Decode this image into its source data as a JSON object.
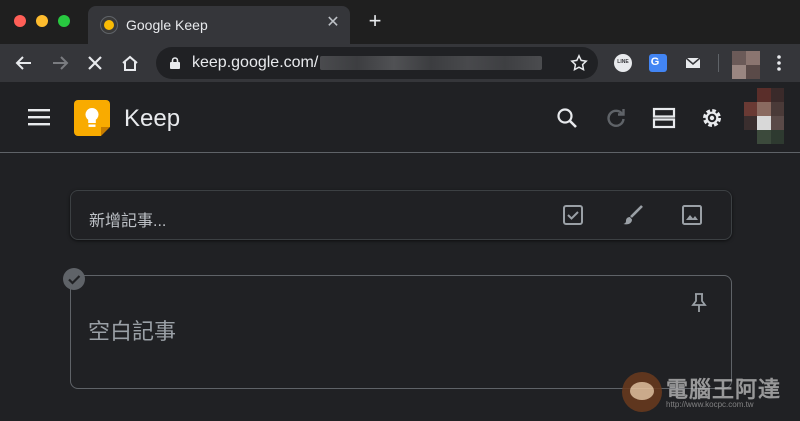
{
  "browser": {
    "tab": {
      "title": "Google Keep",
      "close_glyph": "✕"
    },
    "new_tab_glyph": "+",
    "omnibox": {
      "url": "keep.google.com/"
    },
    "extensions": [
      "line-icon",
      "google-translate-icon",
      "mail-icon"
    ]
  },
  "keep": {
    "app_name": "Keep",
    "header_icons": [
      "search-icon",
      "refresh-icon",
      "list-view-icon",
      "settings-icon"
    ],
    "take_note": {
      "placeholder": "新增記事...",
      "actions": [
        "checkbox-icon",
        "brush-icon",
        "image-icon"
      ]
    },
    "notes": [
      {
        "title": "空白記事"
      }
    ]
  },
  "watermark": {
    "text": "電腦王阿達",
    "url": "http://www.kocpc.com.tw"
  },
  "colors": {
    "background": "#202124",
    "browser_frame": "#1f1f1f",
    "toolbar": "#35363a",
    "keep_yellow": "#f9ab00",
    "text_primary": "#e8eaed",
    "text_secondary": "#9aa0a6"
  }
}
